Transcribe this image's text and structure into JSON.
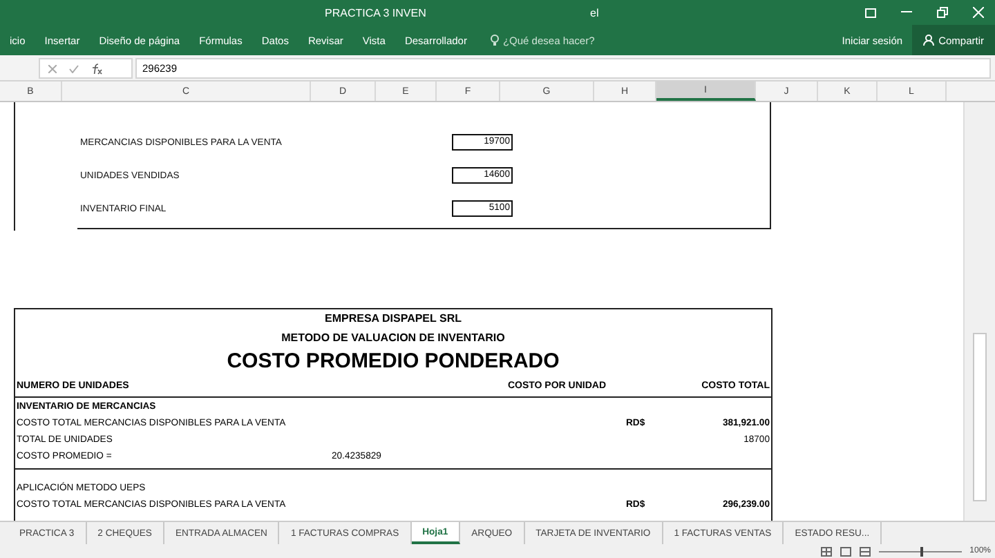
{
  "window": {
    "title_parts": [
      "PRACTICA 3 INVEN",
      "el"
    ]
  },
  "ribbon_tabs": [
    "icio",
    "Insertar",
    "Diseño de página",
    "Fórmulas",
    "Datos",
    "Revisar",
    "Vista",
    "Desarrollador"
  ],
  "tell_me": {
    "placeholder": "¿Qué desea hacer?"
  },
  "account": {
    "sign_in": "Iniciar sesión",
    "share": "Compartir"
  },
  "formula_bar": {
    "value": "296239"
  },
  "columns": [
    {
      "label": "B",
      "selected": false
    },
    {
      "label": "C",
      "selected": false
    },
    {
      "label": "D",
      "selected": false
    },
    {
      "label": "E",
      "selected": false
    },
    {
      "label": "F",
      "selected": false
    },
    {
      "label": "G",
      "selected": false
    },
    {
      "label": "H",
      "selected": false
    },
    {
      "label": "I",
      "selected": true
    },
    {
      "label": "J",
      "selected": false
    },
    {
      "label": "K",
      "selected": false
    },
    {
      "label": "L",
      "selected": false
    }
  ],
  "summary": [
    {
      "label": "MERCANCIAS DISPONIBLES PARA LA VENTA",
      "value": "19700"
    },
    {
      "label": "UNIDADES VENDIDAS",
      "value": "14600"
    },
    {
      "label": "INVENTARIO FINAL",
      "value": "5100"
    }
  ],
  "report": {
    "titles": [
      "EMPRESA DISPAPEL SRL",
      "METODO DE VALUACION DE INVENTARIO"
    ],
    "heading": "COSTO PROMEDIO PONDERADO",
    "headers": [
      "NUMERO DE UNIDADES",
      "COSTO POR UNIDAD",
      "COSTO TOTAL"
    ],
    "sections": [
      {
        "rows": [
          {
            "label": "INVENTARIO DE MERCANCIAS",
            "bold": true
          },
          {
            "label": " COSTO TOTAL MERCANCIAS DISPONIBLES PARA LA VENTA",
            "currency": "RD$",
            "total": "381,921.00",
            "bold": false
          },
          {
            "label": "TOTAL DE UNIDADES",
            "total": "18700",
            "bold": false
          },
          {
            "label": "COSTO PROMEDIO =",
            "unit": "20.4235829",
            "bold": false
          }
        ]
      },
      {
        "rows": [
          {
            "label": "APLICACIÓN METODO UEPS",
            "bold": false
          },
          {
            "label": " COSTO TOTAL MERCANCIAS DISPONIBLES PARA LA VENTA",
            "currency": "RD$",
            "total": "296,239.00",
            "bold": false
          }
        ]
      }
    ]
  },
  "sheet_tabs": [
    {
      "label": "PRACTICA 3",
      "selected": false
    },
    {
      "label": "2 CHEQUES",
      "selected": false
    },
    {
      "label": "ENTRADA ALMACEN",
      "selected": false
    },
    {
      "label": "1 FACTURAS COMPRAS",
      "selected": false
    },
    {
      "label": "Hoja1",
      "selected": true
    },
    {
      "label": "ARQUEO",
      "selected": false
    },
    {
      "label": "TARJETA DE INVENTARIO",
      "selected": false
    },
    {
      "label": "1 FACTURAS VENTAS",
      "selected": false
    },
    {
      "label": "ESTADO RESU...",
      "selected": false
    }
  ],
  "status_bar": {
    "zoom": {
      "level": 0.5,
      "reading": "100%"
    }
  }
}
